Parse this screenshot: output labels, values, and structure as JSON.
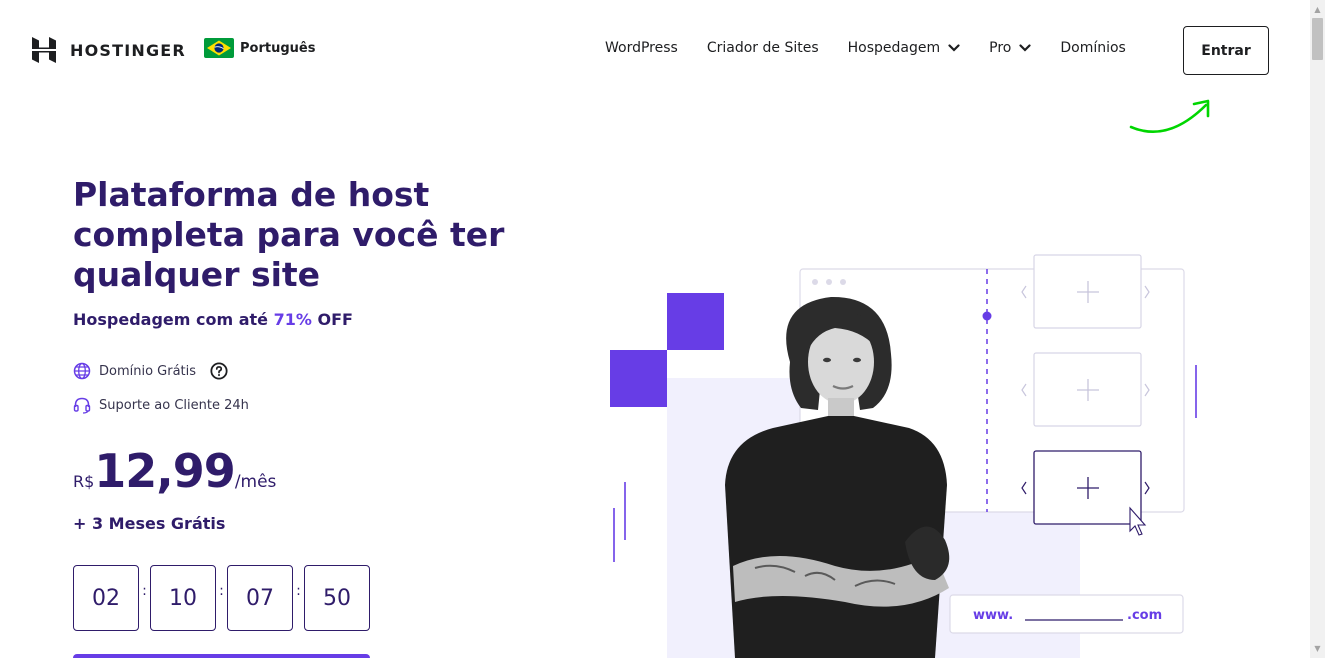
{
  "brand": {
    "name": "HOSTINGER",
    "language": "Português",
    "colors": {
      "primary": "#673de6",
      "dark": "#2f1c6a",
      "doodle": "#00d600"
    }
  },
  "nav": {
    "items": [
      {
        "label": "WordPress",
        "has_dropdown": false
      },
      {
        "label": "Criador de Sites",
        "has_dropdown": false
      },
      {
        "label": "Hospedagem",
        "has_dropdown": true
      },
      {
        "label": "Pro",
        "has_dropdown": true
      },
      {
        "label": "Domínios",
        "has_dropdown": false
      }
    ],
    "login_label": "Entrar"
  },
  "hero": {
    "title": "Plataforma de host completa para você ter qualquer site",
    "subtitle_prefix": "Hospedagem com até ",
    "subtitle_discount": "71%",
    "subtitle_suffix": " OFF",
    "features": [
      {
        "label": "Domínio Grátis",
        "icon": "globe-icon",
        "has_help": true
      },
      {
        "label": "Suporte ao Cliente 24h",
        "icon": "headset-icon",
        "has_help": false
      }
    ],
    "price": {
      "currency": "R$",
      "amount": "12,99",
      "period": "/mês"
    },
    "bonus": "+ 3 Meses Grátis",
    "countdown": [
      "02",
      "10",
      "07",
      "50"
    ],
    "countdown_separator": ":"
  },
  "illustration": {
    "domain_prefix": "www.",
    "domain_suffix": ".com"
  }
}
